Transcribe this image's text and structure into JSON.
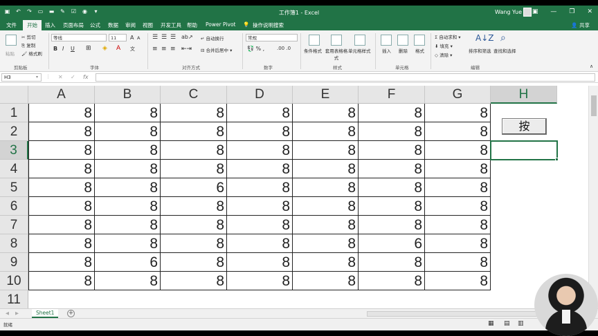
{
  "window": {
    "title": "工作簿1 - Excel",
    "user": "Wang Yue"
  },
  "ribbon_tabs": [
    "文件",
    "开始",
    "插入",
    "页面布局",
    "公式",
    "数据",
    "审阅",
    "视图",
    "开发工具",
    "帮助",
    "Power Pivot",
    "操作说明搜索"
  ],
  "active_tab": "开始",
  "share_label": "共享",
  "ribbon": {
    "clipboard": {
      "paste": "粘贴",
      "cut": "剪切",
      "copy": "复制",
      "format_painter": "格式刷",
      "label": "剪贴板"
    },
    "font": {
      "name": "等线",
      "size": "11",
      "bold": "B",
      "italic": "I",
      "underline": "U",
      "label": "字体"
    },
    "alignment": {
      "wrap": "自动换行",
      "merge": "合并后居中",
      "label": "对齐方式"
    },
    "number": {
      "format": "常规",
      "label": "数字"
    },
    "styles": {
      "conditional": "条件格式",
      "table": "套用表格格式",
      "cell": "单元格样式",
      "label": "样式"
    },
    "cells": {
      "insert": "插入",
      "delete": "删除",
      "format": "格式",
      "label": "单元格"
    },
    "editing": {
      "autosum": "自动求和",
      "fill": "填充",
      "clear": "清除",
      "sort": "排序和筛选",
      "find": "查找和选择",
      "label": "编辑"
    }
  },
  "formula_bar": {
    "name_box": "H3",
    "fx": "fx",
    "value": ""
  },
  "columns": [
    "A",
    "B",
    "C",
    "D",
    "E",
    "F",
    "G",
    "H"
  ],
  "rows": [
    "1",
    "2",
    "3",
    "4",
    "5",
    "6",
    "7",
    "8",
    "9",
    "10",
    "11"
  ],
  "cells": [
    [
      "8",
      "8",
      "8",
      "8",
      "8",
      "8",
      "8"
    ],
    [
      "8",
      "8",
      "8",
      "8",
      "8",
      "8",
      "8"
    ],
    [
      "8",
      "8",
      "8",
      "8",
      "8",
      "8",
      "8"
    ],
    [
      "8",
      "8",
      "8",
      "8",
      "8",
      "8",
      "8"
    ],
    [
      "8",
      "8",
      "6",
      "8",
      "8",
      "8",
      "8"
    ],
    [
      "8",
      "8",
      "8",
      "8",
      "8",
      "8",
      "8"
    ],
    [
      "8",
      "8",
      "8",
      "8",
      "8",
      "8",
      "8"
    ],
    [
      "8",
      "8",
      "8",
      "8",
      "8",
      "6",
      "8"
    ],
    [
      "8",
      "6",
      "8",
      "8",
      "8",
      "8",
      "8"
    ],
    [
      "8",
      "8",
      "8",
      "8",
      "8",
      "8",
      "8"
    ]
  ],
  "selected_cell": {
    "column": "H",
    "row": "3"
  },
  "press_button": "按",
  "sheet_tabs": [
    "Sheet1"
  ],
  "status": "就绪",
  "colors": {
    "excel_green": "#217346"
  }
}
